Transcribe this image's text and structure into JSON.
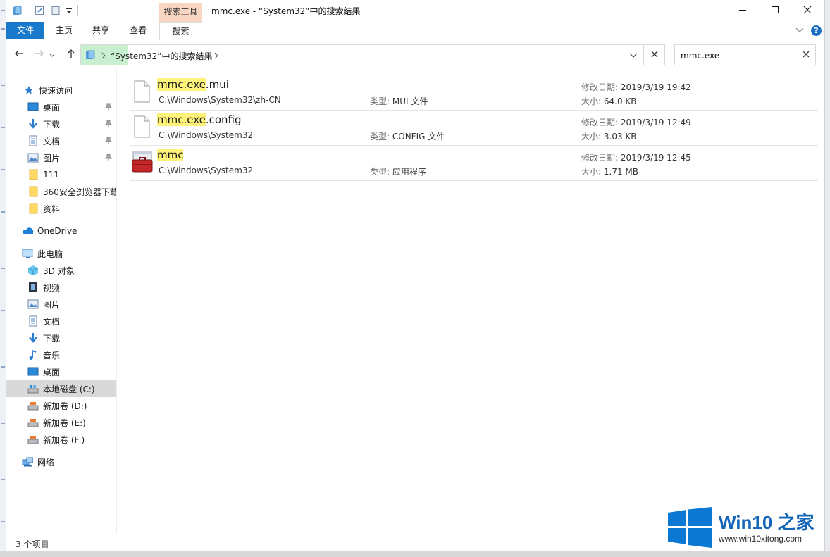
{
  "window": {
    "title": "mmc.exe - “System32”中的搜索结果",
    "contextual_tab": "搜索工具"
  },
  "ribbon": {
    "tabs": [
      {
        "label": "文件"
      },
      {
        "label": "主页"
      },
      {
        "label": "共享"
      },
      {
        "label": "查看"
      },
      {
        "label": "搜索"
      }
    ]
  },
  "address": {
    "breadcrumb": "“System32”中的搜索结果",
    "search_value": "mmc.exe"
  },
  "nav": {
    "items": [
      {
        "label": "快速访问",
        "icon": "star-icon",
        "level": 0,
        "pinned": false
      },
      {
        "label": "桌面",
        "icon": "desktop-icon",
        "level": 1,
        "pinned": true
      },
      {
        "label": "下载",
        "icon": "download-icon",
        "level": 1,
        "pinned": true
      },
      {
        "label": "文档",
        "icon": "document-icon",
        "level": 1,
        "pinned": true
      },
      {
        "label": "图片",
        "icon": "pictures-icon",
        "level": 1,
        "pinned": true
      },
      {
        "label": "111",
        "icon": "folder-icon",
        "level": 1,
        "pinned": false
      },
      {
        "label": "360安全浏览器下载",
        "icon": "folder-icon",
        "level": 1,
        "pinned": false
      },
      {
        "label": "资料",
        "icon": "folder-icon",
        "level": 1,
        "pinned": false
      },
      {
        "label": "OneDrive",
        "icon": "cloud-icon",
        "level": 0,
        "pinned": false
      },
      {
        "label": "此电脑",
        "icon": "computer-icon",
        "level": 0,
        "pinned": false
      },
      {
        "label": "3D 对象",
        "icon": "cube-icon",
        "level": 1,
        "pinned": false
      },
      {
        "label": "视频",
        "icon": "video-icon",
        "level": 1,
        "pinned": false
      },
      {
        "label": "图片",
        "icon": "pictures-icon",
        "level": 1,
        "pinned": false
      },
      {
        "label": "文档",
        "icon": "document-icon",
        "level": 1,
        "pinned": false
      },
      {
        "label": "下载",
        "icon": "download-icon",
        "level": 1,
        "pinned": false
      },
      {
        "label": "音乐",
        "icon": "music-icon",
        "level": 1,
        "pinned": false
      },
      {
        "label": "桌面",
        "icon": "desktop-icon",
        "level": 1,
        "pinned": false
      },
      {
        "label": "本地磁盘 (C:)",
        "icon": "drive-icon",
        "level": 1,
        "pinned": false,
        "selected": true
      },
      {
        "label": "新加卷 (D:)",
        "icon": "drive-icon",
        "level": 1,
        "pinned": false
      },
      {
        "label": "新加卷 (E:)",
        "icon": "drive-icon",
        "level": 1,
        "pinned": false
      },
      {
        "label": "新加卷 (F:)",
        "icon": "drive-icon",
        "level": 1,
        "pinned": false
      },
      {
        "label": "网络",
        "icon": "network-icon",
        "level": 0,
        "pinned": false
      }
    ]
  },
  "results": [
    {
      "name_match": "mmc.exe",
      "name_rest": ".mui",
      "path": "C:\\Windows\\System32\\zh-CN",
      "type_label": "类型:",
      "type": "MUI 文件",
      "modified_label": "修改日期:",
      "modified": "2019/3/19 19:42",
      "size_label": "大小:",
      "size": "64.0 KB",
      "icon": "file-icon"
    },
    {
      "name_match": "mmc.exe",
      "name_rest": ".config",
      "path": "C:\\Windows\\System32",
      "type_label": "类型:",
      "type": "CONFIG 文件",
      "modified_label": "修改日期:",
      "modified": "2019/3/19 12:49",
      "size_label": "大小:",
      "size": "3.03 KB",
      "icon": "file-icon"
    },
    {
      "name_match": "mmc",
      "name_rest": "",
      "path": "C:\\Windows\\System32",
      "type_label": "类型:",
      "type": "应用程序",
      "modified_label": "修改日期:",
      "modified": "2019/3/19 12:45",
      "size_label": "大小:",
      "size": "1.71 MB",
      "icon": "toolbox-icon"
    }
  ],
  "status": {
    "item_count": "3 个项目"
  },
  "watermark": {
    "title": "Win10 之家",
    "url": "www.win10xitong.com"
  },
  "colors": {
    "accent": "#1979ca",
    "contextual_tab": "#f8d6c1",
    "highlight": "#fff27a",
    "selection": "#d9d9d9"
  }
}
